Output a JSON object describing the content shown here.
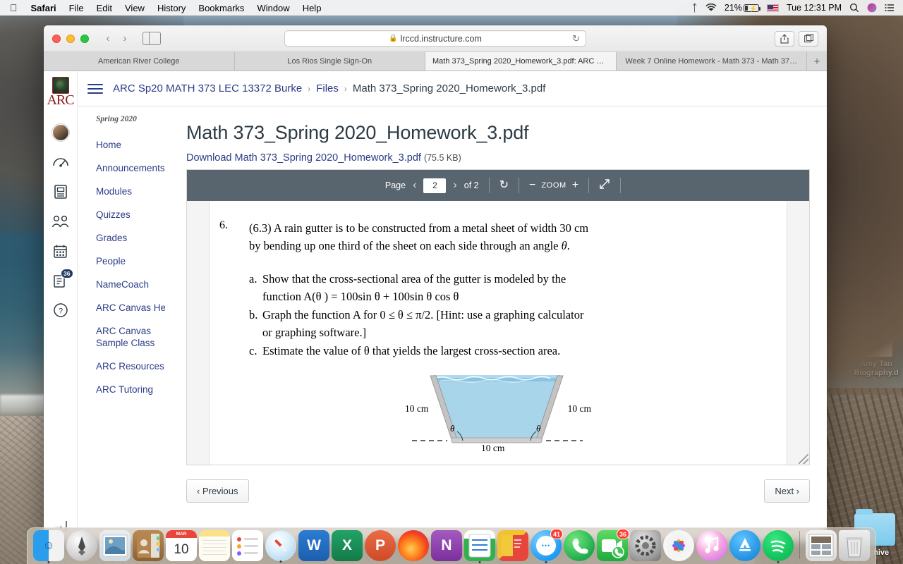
{
  "menubar": {
    "apple_icon": "apple-icon",
    "items": [
      {
        "label": "Safari",
        "bold": true
      },
      {
        "label": "File",
        "bold": false
      },
      {
        "label": "Edit",
        "bold": false
      },
      {
        "label": "View",
        "bold": false
      },
      {
        "label": "History",
        "bold": false
      },
      {
        "label": "Bookmarks",
        "bold": false
      },
      {
        "label": "Window",
        "bold": false
      },
      {
        "label": "Help",
        "bold": false
      }
    ],
    "status": {
      "bluetooth_icon": "bluetooth-icon",
      "wifi_icon": "wifi-icon",
      "battery_percent": "21%",
      "battery_charging_icon": "charging-bolt-icon",
      "input_flag": "US flag",
      "clock": "Tue 12:31 PM",
      "search_icon": "spotlight-search-icon",
      "siri_icon": "siri-icon",
      "control_center_icon": "notification-center-icon"
    }
  },
  "safari": {
    "window_controls": {
      "close": "close",
      "minimize": "minimize",
      "zoom": "zoom"
    },
    "back_icon": "chevron-left-icon",
    "forward_icon": "chevron-right-icon",
    "sidebar_icon": "sidebar-toggle-icon",
    "address": {
      "lock_icon": "lock-icon",
      "url": "lrccd.instructure.com",
      "reload_icon": "reload-icon"
    },
    "share_icon": "share-icon",
    "new_tab_icon": "tab-overview-icon",
    "tabs": [
      {
        "title": "American River College",
        "active": false
      },
      {
        "title": "Los Rios Single Sign-On",
        "active": false
      },
      {
        "title": "Math 373_Spring 2020_Homework_3.pdf: ARC S…",
        "active": true
      },
      {
        "title": "Week 7 Online Homework - Math 373 - Math 37…",
        "active": false
      }
    ],
    "new_tab_button": "+"
  },
  "canvas": {
    "global_nav": {
      "logo_text": "ARC",
      "items": [
        {
          "name": "account-avatar",
          "icon": "avatar-icon",
          "badge": null
        },
        {
          "name": "dashboard",
          "icon": "dashboard-icon",
          "badge": null
        },
        {
          "name": "courses",
          "icon": "courses-book-icon",
          "badge": null
        },
        {
          "name": "groups",
          "icon": "groups-people-icon",
          "badge": null
        },
        {
          "name": "calendar",
          "icon": "calendar-icon",
          "badge": null
        },
        {
          "name": "inbox",
          "icon": "inbox-icon",
          "badge": "36"
        },
        {
          "name": "help",
          "icon": "help-question-icon",
          "badge": null
        }
      ],
      "expand_icon": "expand-arrow-icon"
    },
    "breadcrumb": {
      "menu_icon": "hamburger-menu-icon",
      "items": [
        "ARC Sp20 MATH 373 LEC 13372 Burke",
        "Files",
        "Math 373_Spring 2020_Homework_3.pdf"
      ],
      "separator": "›"
    },
    "course_nav": {
      "term": "Spring 2020",
      "items": [
        "Home",
        "Announcements",
        "Modules",
        "Quizzes",
        "Grades",
        "People",
        "NameCoach",
        "ARC Canvas Help",
        "ARC Canvas Sample Class",
        "ARC Resources",
        "ARC Tutoring"
      ]
    },
    "page": {
      "title": "Math 373_Spring 2020_Homework_3.pdf",
      "download_link": "Download Math 373_Spring 2020_Homework_3.pdf",
      "file_size": "(75.5 KB)"
    },
    "pdf_toolbar": {
      "page_label": "Page",
      "prev_icon": "chevron-left-icon",
      "page_value": "2",
      "next_icon": "chevron-right-icon",
      "of_label": "of 2",
      "rotate_icon": "rotate-icon",
      "zoom_out_icon": "minus-icon",
      "zoom_label": "ZOOM",
      "zoom_in_icon": "plus-icon",
      "fullscreen_icon": "fullscreen-expand-icon"
    },
    "pdf_content": {
      "question_number": "6.",
      "question_text_line1": "(6.3) A rain gutter is to be constructed from a metal sheet of width 30 cm",
      "question_text_line2": "by bending up one third of the sheet on each side through an angle",
      "question_theta": "θ",
      "question_period": ".",
      "parts": [
        {
          "label": "a.",
          "line1": "Show that the cross-sectional area of the gutter is modeled by the",
          "line2_prefix": "function ",
          "line2_math": "A(θ ) = 100sin θ + 100sin θ cos θ"
        },
        {
          "label": "b.",
          "line1": "Graph the function A for 0 ≤ θ ≤ π/2. [Hint: use a graphing calculator",
          "line2_prefix": "",
          "line2_math": "or graphing software.]"
        },
        {
          "label": "c.",
          "line1": "Estimate the value of θ that yields the largest cross-section area.",
          "line2_prefix": "",
          "line2_math": ""
        }
      ],
      "figure": {
        "name": "rain-gutter-trapezoid-diagram",
        "left_label": "10 cm",
        "right_label": "10 cm",
        "bottom_label": "10 cm",
        "angle_left": "θ",
        "angle_right": "θ",
        "water_color": "#a8d5ea",
        "metal_color": "#b9b9b9"
      }
    },
    "pagination": {
      "previous": "‹ Previous",
      "next": "Next ›"
    }
  },
  "desktop": {
    "icons": [
      {
        "name": "word-document-icon",
        "label_line1": "Amy Tan",
        "label_line2": "Biography.d"
      },
      {
        "name": "folder-icon",
        "label_line1": "Archive",
        "label_line2": ""
      }
    ]
  },
  "dock": {
    "apps": [
      {
        "name": "finder",
        "label": "Finder",
        "running": true,
        "badge": null
      },
      {
        "name": "launchpad",
        "label": "Launchpad",
        "running": false,
        "badge": null
      },
      {
        "name": "mail",
        "label": "Mail",
        "running": false,
        "badge": null
      },
      {
        "name": "contacts",
        "label": "Contacts",
        "running": false,
        "badge": null
      },
      {
        "name": "calendar",
        "label": "Calendar",
        "running": false,
        "badge": null,
        "month": "MAR",
        "day": "10"
      },
      {
        "name": "notes",
        "label": "Notes",
        "running": false,
        "badge": null
      },
      {
        "name": "reminders",
        "label": "Reminders",
        "running": false,
        "badge": null
      },
      {
        "name": "safari",
        "label": "Safari",
        "running": true,
        "badge": null
      },
      {
        "name": "word",
        "label": "Microsoft Word",
        "running": false,
        "badge": null,
        "glyph": "W"
      },
      {
        "name": "excel",
        "label": "Microsoft Excel",
        "running": false,
        "badge": null,
        "glyph": "X"
      },
      {
        "name": "powerpoint",
        "label": "Microsoft PowerPoint",
        "running": false,
        "badge": null,
        "glyph": "P"
      },
      {
        "name": "firefox",
        "label": "Firefox",
        "running": false,
        "badge": null
      },
      {
        "name": "onenote",
        "label": "Microsoft OneNote",
        "running": false,
        "badge": null,
        "glyph": "N"
      },
      {
        "name": "numbers",
        "label": "Numbers",
        "running": false,
        "badge": null
      },
      {
        "name": "stickies",
        "label": "Stickies",
        "running": false,
        "badge": null
      },
      {
        "name": "messages",
        "label": "Messages",
        "running": true,
        "badge": "41"
      },
      {
        "name": "whatsapp",
        "label": "WhatsApp",
        "running": false,
        "badge": null
      },
      {
        "name": "facetime",
        "label": "FaceTime",
        "running": false,
        "badge": "36"
      },
      {
        "name": "system-preferences",
        "label": "System Preferences",
        "running": false,
        "badge": null
      },
      {
        "name": "photos",
        "label": "Photos",
        "running": false,
        "badge": null
      },
      {
        "name": "itunes",
        "label": "iTunes",
        "running": false,
        "badge": null
      },
      {
        "name": "app-store",
        "label": "App Store",
        "running": false,
        "badge": null
      },
      {
        "name": "spotify",
        "label": "Spotify",
        "running": true,
        "badge": null
      },
      {
        "name": "preview-document",
        "label": "Recent document",
        "running": false,
        "badge": null
      },
      {
        "name": "trash",
        "label": "Trash",
        "running": false,
        "badge": null
      }
    ]
  },
  "colors": {
    "canvas_link": "#2b3c86",
    "pdf_toolbar": "#58656f",
    "badge_blue": "#1f3b63",
    "badge_red": "#ff3b30"
  }
}
